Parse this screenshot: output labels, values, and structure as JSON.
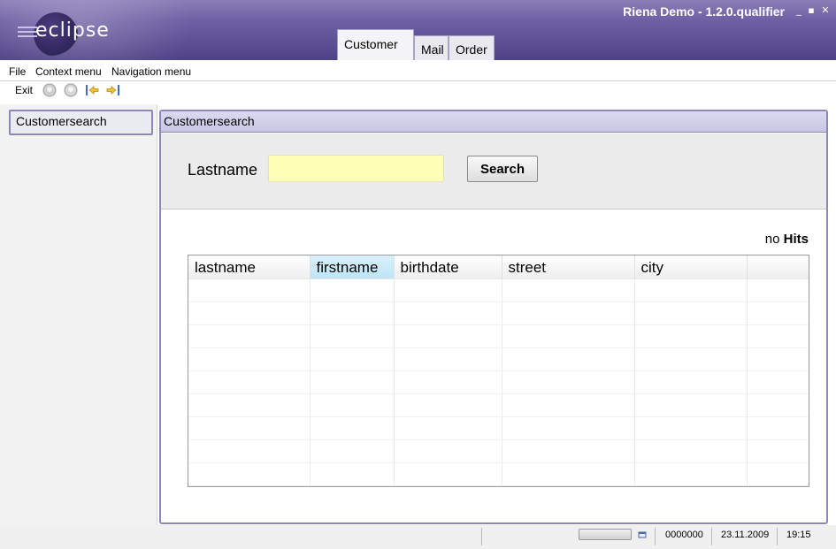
{
  "window": {
    "title": "Riena Demo - 1.2.0.qualifier",
    "logo_text": "eclipse",
    "controls": {
      "minimize": "_",
      "maximize": "▪",
      "close": "✕"
    }
  },
  "tabs": [
    {
      "label": "Customer",
      "active": true
    },
    {
      "label": "Mail",
      "active": false
    },
    {
      "label": "Order",
      "active": false
    }
  ],
  "menubar": {
    "items": [
      "File",
      "Context menu",
      "Navigation menu"
    ]
  },
  "toolbar": {
    "exit_label": "Exit",
    "icons": [
      "back-gray-icon",
      "forward-gray-icon",
      "navigate-back-icon",
      "navigate-forward-icon"
    ]
  },
  "navigation": {
    "items": [
      {
        "label": "Customersearch",
        "selected": true
      }
    ]
  },
  "module": {
    "title": "Customersearch",
    "search": {
      "lastname_label": "Lastname",
      "lastname_value": "",
      "search_button": "Search"
    },
    "hits": {
      "prefix": "no",
      "word": "Hits"
    },
    "table": {
      "columns": [
        "lastname",
        "firstname",
        "birthdate",
        "street",
        "city",
        ""
      ],
      "sorted_column": "firstname",
      "rows": []
    }
  },
  "statusbar": {
    "number": "0000000",
    "date": "23.11.2009",
    "time": "19:15"
  },
  "colors": {
    "titlebar": "#5e5196",
    "accent_border": "#8c87b8",
    "input_background": "#ffffb8",
    "sorted_header": "#c8e9f7"
  }
}
